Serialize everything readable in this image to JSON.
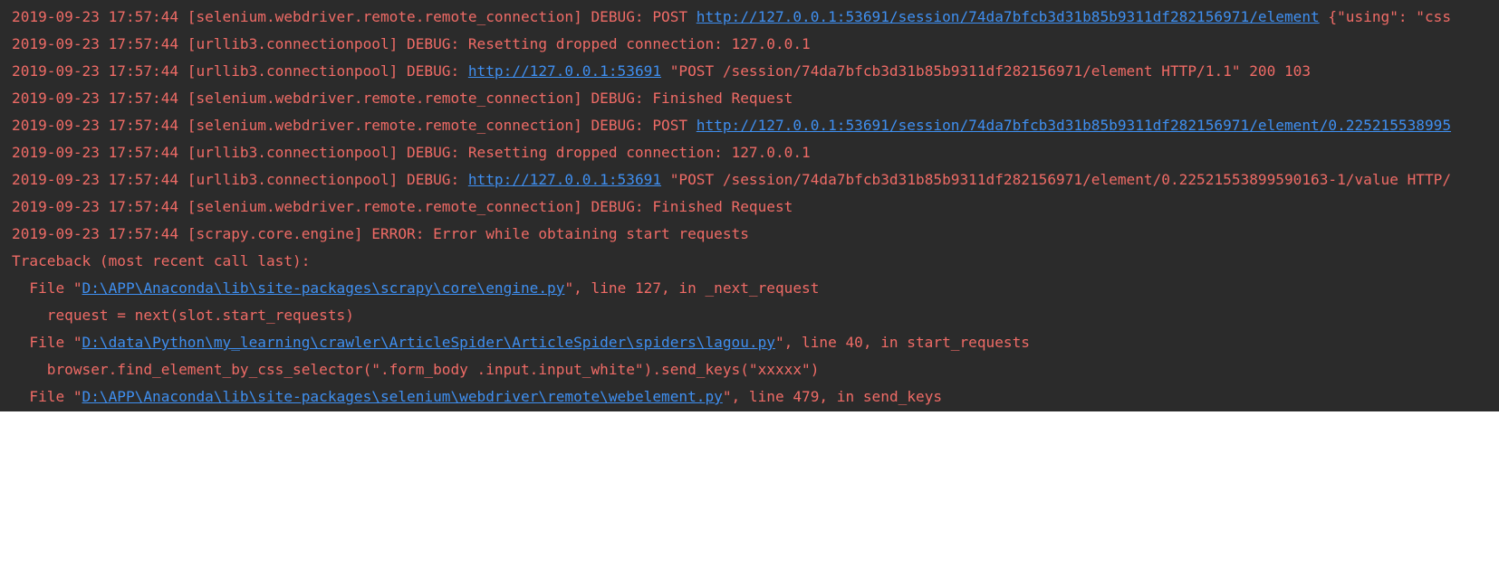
{
  "colors": {
    "console_bg": "#2b2b2b",
    "error_text": "#ef6b66",
    "link_text": "#3f8ff0",
    "page_bg": "#ffffff"
  },
  "log": {
    "lines": [
      {
        "prefix": "2019-09-23 17:57:44 [selenium.webdriver.remote.remote_connection] DEBUG: POST ",
        "link": "http://127.0.0.1:53691/session/74da7bfcb3d31b85b9311df282156971/element",
        "suffix": " {\"using\": \"css"
      },
      {
        "prefix": "2019-09-23 17:57:44 [urllib3.connectionpool] DEBUG: Resetting dropped connection: 127.0.0.1",
        "link": "",
        "suffix": ""
      },
      {
        "prefix": "2019-09-23 17:57:44 [urllib3.connectionpool] DEBUG: ",
        "link": "http://127.0.0.1:53691",
        "suffix": " \"POST /session/74da7bfcb3d31b85b9311df282156971/element HTTP/1.1\" 200 103"
      },
      {
        "prefix": "2019-09-23 17:57:44 [selenium.webdriver.remote.remote_connection] DEBUG: Finished Request",
        "link": "",
        "suffix": ""
      },
      {
        "prefix": "2019-09-23 17:57:44 [selenium.webdriver.remote.remote_connection] DEBUG: POST ",
        "link": "http://127.0.0.1:53691/session/74da7bfcb3d31b85b9311df282156971/element/0.225215538995",
        "suffix": ""
      },
      {
        "prefix": "2019-09-23 17:57:44 [urllib3.connectionpool] DEBUG: Resetting dropped connection: 127.0.0.1",
        "link": "",
        "suffix": ""
      },
      {
        "prefix": "2019-09-23 17:57:44 [urllib3.connectionpool] DEBUG: ",
        "link": "http://127.0.0.1:53691",
        "suffix": " \"POST /session/74da7bfcb3d31b85b9311df282156971/element/0.22521553899590163-1/value HTTP/"
      },
      {
        "prefix": "2019-09-23 17:57:44 [selenium.webdriver.remote.remote_connection] DEBUG: Finished Request",
        "link": "",
        "suffix": ""
      },
      {
        "prefix": "2019-09-23 17:57:44 [scrapy.core.engine] ERROR: Error while obtaining start requests",
        "link": "",
        "suffix": ""
      },
      {
        "prefix": "Traceback (most recent call last):",
        "link": "",
        "suffix": ""
      },
      {
        "prefix": "  File \"",
        "link": "D:\\APP\\Anaconda\\lib\\site-packages\\scrapy\\core\\engine.py",
        "suffix": "\", line 127, in _next_request"
      },
      {
        "prefix": "    request = next(slot.start_requests)",
        "link": "",
        "suffix": ""
      },
      {
        "prefix": "  File \"",
        "link": "D:\\data\\Python\\my_learning\\crawler\\ArticleSpider\\ArticleSpider\\spiders\\lagou.py",
        "suffix": "\", line 40, in start_requests"
      },
      {
        "prefix": "    browser.find_element_by_css_selector(\".form_body .input.input_white\").send_keys(\"xxxxx\")",
        "link": "",
        "suffix": ""
      },
      {
        "prefix": "  File \"",
        "link": "D:\\APP\\Anaconda\\lib\\site-packages\\selenium\\webdriver\\remote\\webelement.py",
        "suffix": "\", line 479, in send_keys"
      }
    ]
  }
}
